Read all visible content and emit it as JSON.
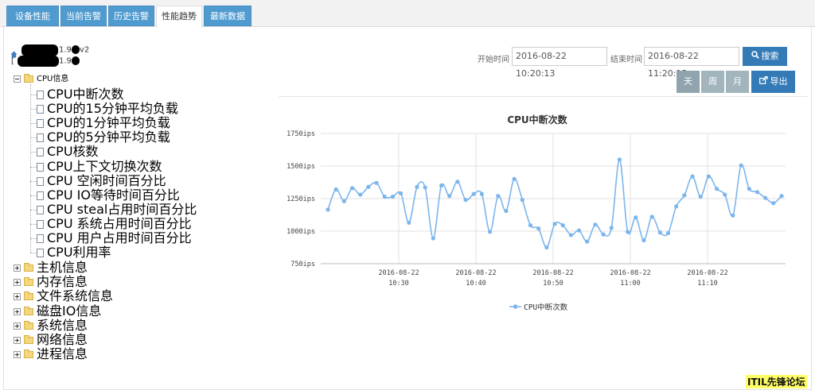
{
  "tabs": [
    {
      "label": "设备性能"
    },
    {
      "label": "当前告警"
    },
    {
      "label": "历史告警"
    },
    {
      "label": "性能趋势",
      "active": true
    },
    {
      "label": "最新数据"
    }
  ],
  "device": {
    "line1": "1.9",
    "line1_suffix": "v2",
    "line2": "1.9"
  },
  "tree": {
    "cpu_group": "CPU信息",
    "cpu_items": [
      "CPU中断次数",
      "CPU的15分钟平均负载",
      "CPU的1分钟平均负载",
      "CPU的5分钟平均负载",
      "CPU核数",
      "CPU上下文切换次数",
      "CPU 空闲时间百分比",
      "CPU IO等待时间百分比",
      "CPU steal占用时间百分比",
      "CPU 系统占用时间百分比",
      "CPU 用户占用时间百分比",
      "CPU利用率"
    ],
    "groups": [
      "主机信息",
      "内存信息",
      "文件系统信息",
      "磁盘IO信息",
      "系统信息",
      "网络信息",
      "进程信息"
    ]
  },
  "search": {
    "start_label": "开始时间",
    "start_value": "2016-08-22 10:20:13",
    "end_label": "结束时间",
    "end_value": "2016-08-22 11:20:13",
    "search_label": "搜索",
    "search_icon": "search-icon"
  },
  "range_buttons": [
    "天",
    "周",
    "月"
  ],
  "export_label": "导出",
  "export_icon": "export-icon",
  "chart_data": {
    "type": "line",
    "title": "CPU中断次数",
    "xlabel": "",
    "ylabel": "",
    "ylim": [
      750,
      1750
    ],
    "yticks": [
      "1750ips",
      "1500ips",
      "1250ips",
      "1000ips",
      "750ips"
    ],
    "xticks": [
      {
        "date": "2016-08-22",
        "time": "10:30"
      },
      {
        "date": "2016-08-22",
        "time": "10:40"
      },
      {
        "date": "2016-08-22",
        "time": "10:50"
      },
      {
        "date": "2016-08-22",
        "time": "11:00"
      },
      {
        "date": "2016-08-22",
        "time": "11:10"
      }
    ],
    "series": [
      {
        "name": "CPU中断次数",
        "color": "#7cb5ec",
        "values": [
          1165,
          1320,
          1230,
          1330,
          1280,
          1340,
          1370,
          1265,
          1265,
          1290,
          1065,
          1340,
          1335,
          945,
          1350,
          1270,
          1380,
          1240,
          1285,
          1285,
          995,
          1270,
          1155,
          1400,
          1240,
          1045,
          1020,
          875,
          1055,
          1045,
          970,
          1005,
          920,
          1050,
          975,
          1025,
          1550,
          995,
          1105,
          930,
          1110,
          990,
          985,
          1190,
          1275,
          1420,
          1265,
          1420,
          1325,
          1280,
          1120,
          1505,
          1325,
          1300,
          1255,
          1215,
          1270
        ]
      }
    ],
    "legend": "bottom-center",
    "grid": true
  },
  "watermark": "ITIL先锋论坛"
}
